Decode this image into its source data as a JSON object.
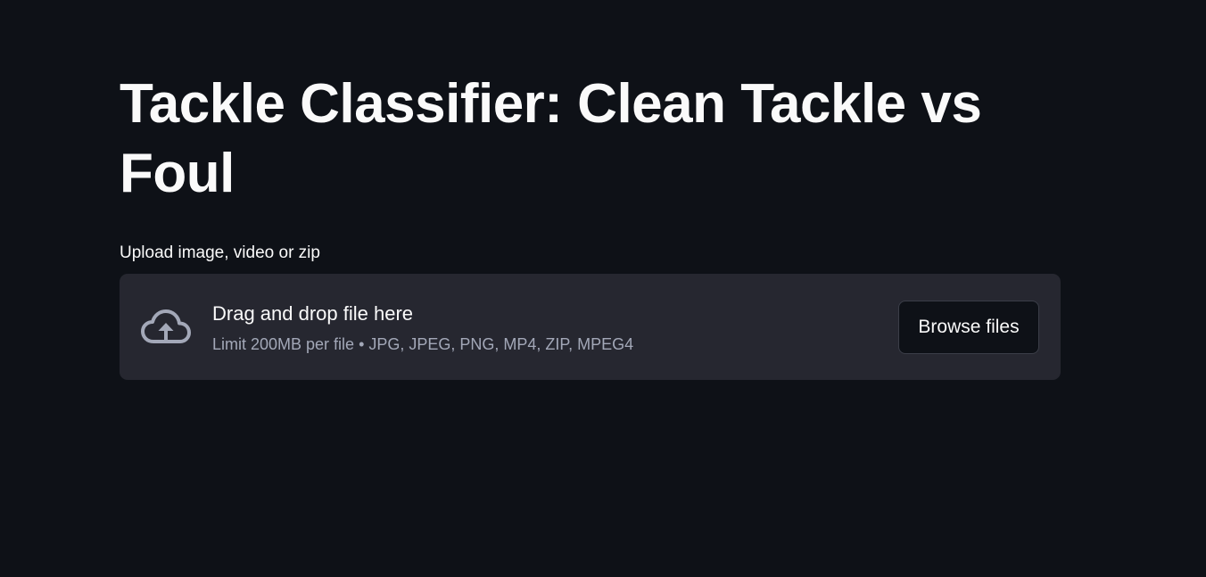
{
  "header": {
    "title": "Tackle Classifier: Clean Tackle vs Foul"
  },
  "uploader": {
    "label": "Upload image, video or zip",
    "drop_text": "Drag and drop file here",
    "limit_text": "Limit 200MB per file • JPG, JPEG, PNG, MP4, ZIP, MPEG4",
    "browse_label": "Browse files",
    "icon": "cloud-upload-icon"
  },
  "colors": {
    "background": "#0e1117",
    "dropzone_bg": "#262730",
    "text_primary": "#fafafa",
    "text_secondary": "#a3a8b8",
    "icon_color": "#a3a8b8"
  }
}
